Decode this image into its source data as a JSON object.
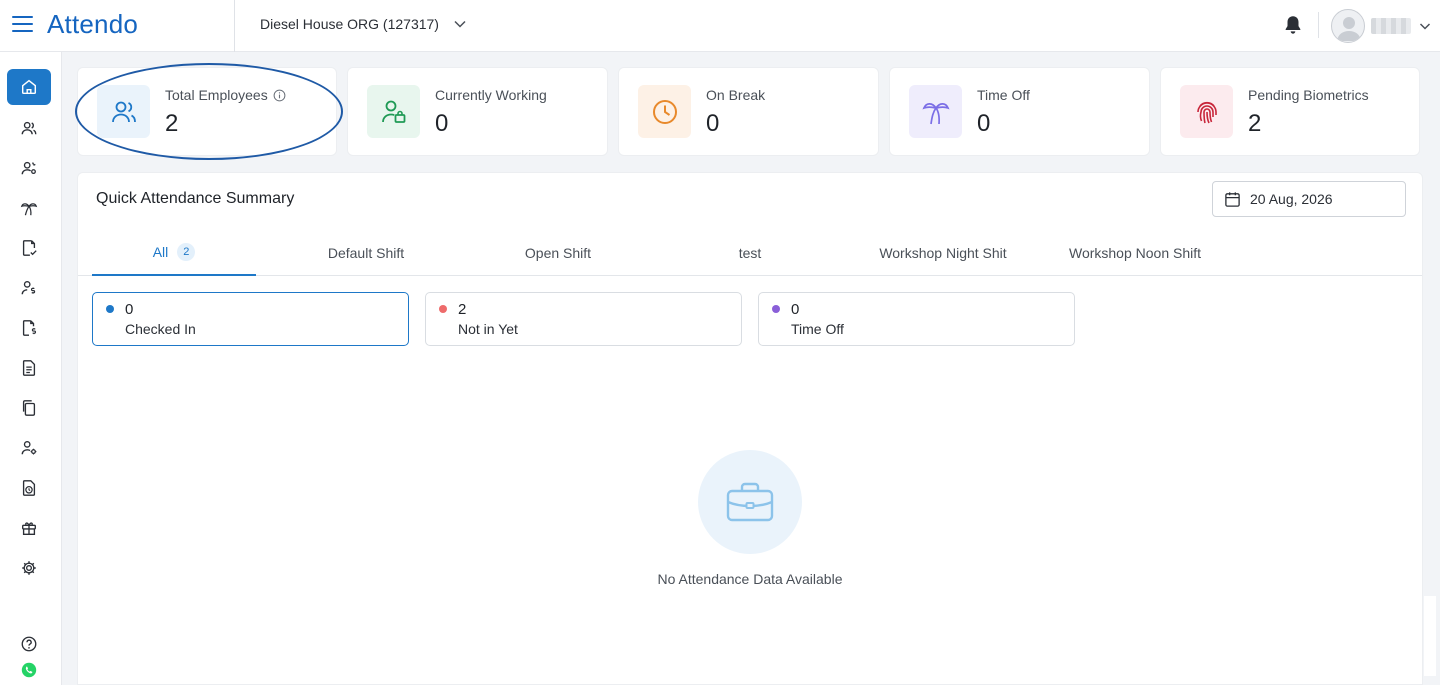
{
  "header": {
    "logo": "Attendo",
    "org_name": "Diesel House ORG (127317)"
  },
  "sidebar": {
    "items": [
      {
        "icon": "home-icon"
      },
      {
        "icon": "users-icon"
      },
      {
        "icon": "user-settings-icon"
      },
      {
        "icon": "palm-tree-icon"
      },
      {
        "icon": "file-check-icon"
      },
      {
        "icon": "user-dollar-icon"
      },
      {
        "icon": "file-dollar-icon"
      },
      {
        "icon": "document-icon"
      },
      {
        "icon": "copy-icon"
      },
      {
        "icon": "user-gear-icon"
      },
      {
        "icon": "clock-file-icon"
      },
      {
        "icon": "gift-icon"
      },
      {
        "icon": "settings-icon"
      }
    ],
    "help_icon": "help-circle-icon",
    "whatsapp_icon": "whatsapp-icon"
  },
  "kpis": [
    {
      "label": "Total Employees",
      "value": "2",
      "color": "#1e78c8",
      "bg": "#eaf3fb"
    },
    {
      "label": "Currently Working",
      "value": "0",
      "color": "#1f9a55",
      "bg": "#e8f6ee"
    },
    {
      "label": "On Break",
      "value": "0",
      "color": "#e8892b",
      "bg": "#fdf1e6"
    },
    {
      "label": "Time Off",
      "value": "0",
      "color": "#7b6ee6",
      "bg": "#efedfc"
    },
    {
      "label": "Pending Biometrics",
      "value": "2",
      "color": "#c8263a",
      "bg": "#fcebee"
    }
  ],
  "summary": {
    "title": "Quick Attendance Summary",
    "date": "20 Aug, 2026",
    "tabs": [
      {
        "label": "All",
        "badge": "2"
      },
      {
        "label": "Default Shift"
      },
      {
        "label": "Open Shift"
      },
      {
        "label": "test"
      },
      {
        "label": "Workshop Night Shit"
      },
      {
        "label": "Workshop Noon Shift"
      }
    ],
    "stats": [
      {
        "count": "0",
        "label": "Checked In",
        "dot": "#1e78c8"
      },
      {
        "count": "2",
        "label": "Not in Yet",
        "dot": "#ee6b6b"
      },
      {
        "count": "0",
        "label": "Time Off",
        "dot": "#8a5fd8"
      }
    ],
    "empty_text": "No Attendance Data Available"
  }
}
